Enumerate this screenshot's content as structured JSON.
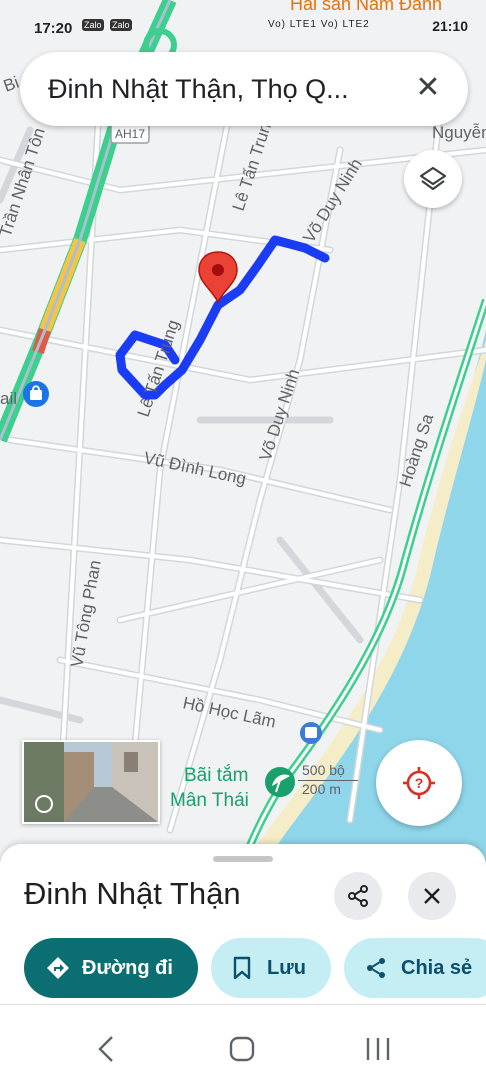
{
  "status_bar": {
    "time": "17:20",
    "left_icons": [
      "Zalo",
      "Zalo"
    ],
    "signal_text": "Vo) LTE1 Vo) LTE2",
    "right_time": "21:10"
  },
  "map": {
    "poi_top": "Hải sản Nam Đảnh",
    "road_shield": "AH17",
    "streets": {
      "tran_nhan_tong": "Trần Nhân Tôn",
      "le_tan_trung_top": "Lê Tấn Trung",
      "le_tan_trung_mid": "Lê Tấn Trung",
      "vo_duy_ninh_top": "Võ Duy Ninh",
      "vo_duy_ninh_mid": "Võ Duy Ninh",
      "nguyen": "Nguyễn",
      "vu_dinh_long": "Vũ Đình Long",
      "vu_tong_phan": "Vũ Tông Phan",
      "ho_hoc_lam": "Hồ Học Lãm",
      "hoang_sa": "Hoàng Sa",
      "bi": "Bi",
      "ail": "ail"
    },
    "beach_label_1": "Bãi tắm",
    "beach_label_2": "Mân Thái",
    "scale_top": "500 bộ",
    "scale_bottom": "200 m",
    "colors": {
      "route": "#1a3cf5",
      "highway": "#3ccf8e",
      "sea": "#8fd6ea",
      "sand": "#f5ecc8",
      "pin": "#ea4335"
    }
  },
  "search": {
    "query": "Đinh Nhật Thận, Thọ Q..."
  },
  "sheet": {
    "title": "Đinh Nhật Thận",
    "directions_label": "Đường đi",
    "save_label": "Lưu",
    "share_label": "Chia sẻ"
  },
  "icons": {
    "close": "close-icon",
    "layers": "layers-icon",
    "locate": "locate-icon",
    "share": "share-icon",
    "directions": "directions-icon",
    "bookmark": "bookmark-icon"
  }
}
